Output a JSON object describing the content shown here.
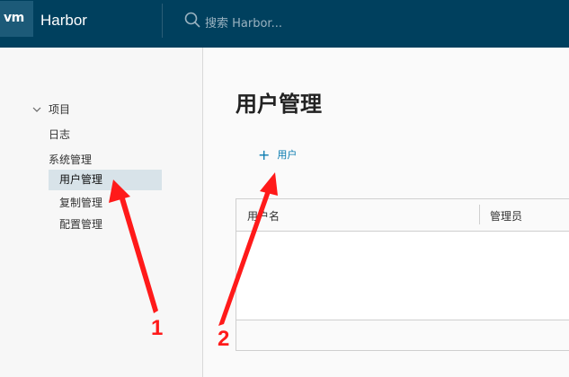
{
  "header": {
    "logo": "vm",
    "brand": "Harbor",
    "search_placeholder": "搜索 Harbor..."
  },
  "sidebar": {
    "items": [
      {
        "label": "项目"
      },
      {
        "label": "日志"
      },
      {
        "label": "系统管理"
      }
    ],
    "admin_children": [
      {
        "label": "用户管理",
        "active": true
      },
      {
        "label": "复制管理"
      },
      {
        "label": "配置管理"
      }
    ]
  },
  "main": {
    "title": "用户管理",
    "add_user_label": "用户",
    "table": {
      "columns": [
        "用户名",
        "管理员"
      ]
    }
  },
  "annotations": {
    "label_1": "1",
    "label_2": "2",
    "color": "#ff1a1a"
  },
  "colors": {
    "header_bg": "#00405e",
    "accent": "#0a7bb0"
  }
}
